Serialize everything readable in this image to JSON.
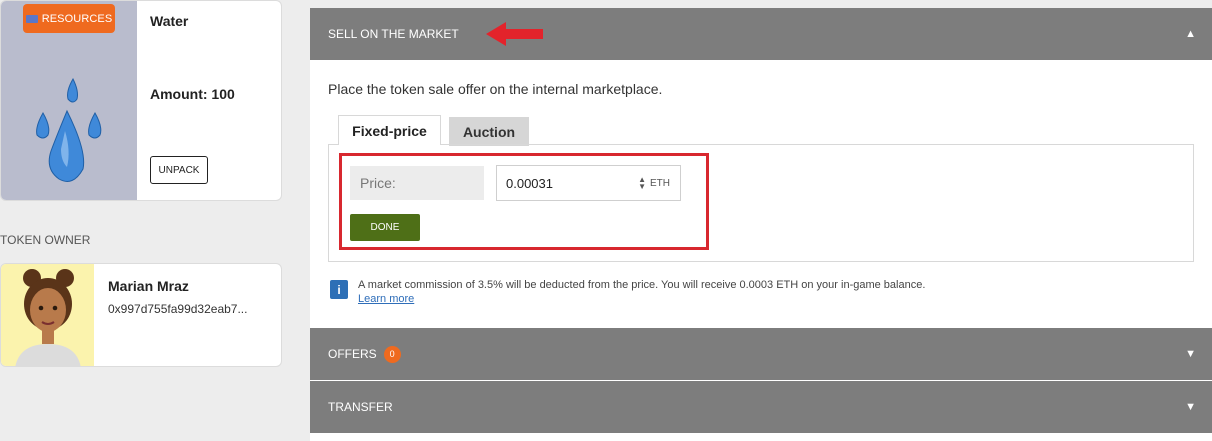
{
  "token": {
    "badge_label": "RESOURCES",
    "name": "Water",
    "amount": "Amount: 100",
    "unpack_label": "UNPACK",
    "image_bg": "#b9bccd"
  },
  "owner": {
    "section_label": "TOKEN OWNER",
    "name": "Marian Mraz",
    "address": "0x997d755fa99d32eab7..."
  },
  "sell": {
    "header": "SELL ON THE MARKET",
    "description": "Place the token sale offer on the internal marketplace.",
    "tabs": [
      {
        "label": "Fixed-price",
        "active": true
      },
      {
        "label": "Auction",
        "active": false
      }
    ],
    "price_label": "Price:",
    "price_value": "0.00031",
    "currency": "ETH",
    "done_label": "DONE",
    "info_icon": "i",
    "info_text": "A market commission of 3.5% will be deducted from the price. You will receive 0.0003 ETH on your in-game balance.",
    "learn_more": "Learn more"
  },
  "offers": {
    "header": "OFFERS",
    "count": "0"
  },
  "transfer": {
    "header": "TRANSFER"
  },
  "colors": {
    "accent_orange": "#ef6a1f",
    "header_gray": "#7d7d7d",
    "done_green": "#4e6f17",
    "highlight_red": "#d8282f",
    "link_blue": "#2f6eb9"
  }
}
